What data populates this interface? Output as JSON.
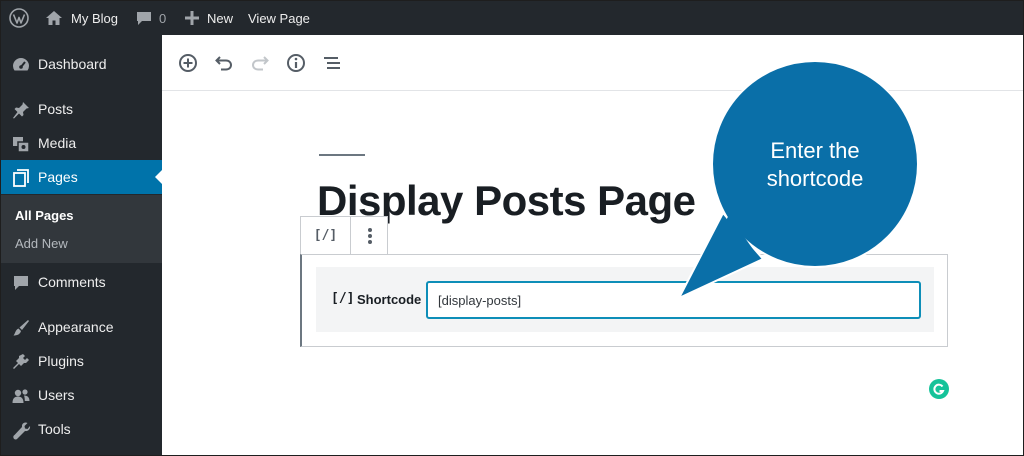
{
  "adminbar": {
    "site_name": "My Blog",
    "comments_count": "0",
    "new_label": "New",
    "view_page_label": "View Page"
  },
  "sidebar": {
    "items": [
      {
        "label": "Dashboard",
        "icon": "dashboard-icon"
      },
      {
        "label": "Posts",
        "icon": "pin-icon"
      },
      {
        "label": "Media",
        "icon": "media-icon"
      },
      {
        "label": "Pages",
        "icon": "pages-icon"
      },
      {
        "label": "Comments",
        "icon": "comment-icon"
      },
      {
        "label": "Appearance",
        "icon": "brush-icon"
      },
      {
        "label": "Plugins",
        "icon": "plug-icon"
      },
      {
        "label": "Users",
        "icon": "users-icon"
      },
      {
        "label": "Tools",
        "icon": "wrench-icon"
      }
    ],
    "submenu": [
      "All Pages",
      "Add New"
    ]
  },
  "editor": {
    "title": "Display Posts Page",
    "block_icon": "[/]",
    "shortcode_icon": "[/]",
    "shortcode_label": "Shortcode",
    "shortcode_value": "[display-posts]"
  },
  "callout": {
    "line1": "Enter the",
    "line2": "shortcode"
  },
  "colors": {
    "admin_bg": "#23282d",
    "accent": "#0073aa",
    "callout": "#0a6fa8",
    "input_focus": "#0e8eb8"
  }
}
